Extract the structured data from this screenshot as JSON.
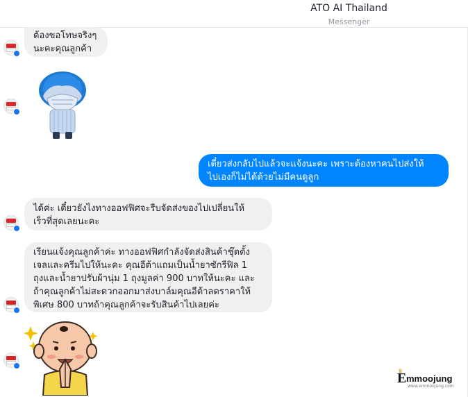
{
  "header": {
    "title": "ATO AI Thailand",
    "subtitle": "Messenger"
  },
  "messages": [
    {
      "direction": "incoming",
      "text_lines": [
        "ต้องขอโทษจริงๆ",
        "นะคะคุณลูกค้า"
      ]
    },
    {
      "direction": "incoming",
      "sticker": "blue-hair-character-covering-face-sticker"
    },
    {
      "direction": "outgoing",
      "text_lines": [
        "เดี๋ยวส่งกลับไปแล้วจะแจ้งนะคะ เพราะต้องหาคนไปส่งให้",
        "ไปเองก็ไม่ได้ด้วยไม่มีคนดูลูก"
      ]
    },
    {
      "direction": "incoming",
      "text_lines": [
        "ได้ค่ะ เดี๋ยวยังไงทางออฟฟิศจะรีบจัดส่งของไปเปลี่ยนให้",
        "เร็วที่สุดเลยนะคะ"
      ]
    },
    {
      "direction": "incoming",
      "text_lines": [
        "เรียนแจ้งคุณลูกค้าค่ะ ทางออฟฟิศกำลังจัดส่งสินค้าชุ๊ตตั้ง",
        "เจลและครีมไปให้นะคะ คุณอีต้าแถมเป็นน้ำยาซักรีฟิล 1",
        "ถุงและน้ำยาปรับผ้านุ่ม 1 ถุงมูลค่า 900 บาทให้นะคะ และ",
        "ถ้าคุณลูกค้าไม่สะดวกออกมาส่งบาล์มคุณอีต้าลดราคาให้",
        "พิเศษ 800 บาทถ้าคุณลูกค้าจะรับสินค้าไปเลยค่ะ"
      ]
    },
    {
      "direction": "incoming",
      "sticker": "bald-man-praying-hands-sticker"
    }
  ],
  "watermark": {
    "text": "mmoojung",
    "initial": "E",
    "url": "www.emmoojung.com"
  },
  "colors": {
    "outgoing_bubble": "#0084ff",
    "incoming_bubble": "#f1f0f0",
    "messenger_badge": "#1a73e8",
    "avatar_logo": "#d9262b"
  }
}
